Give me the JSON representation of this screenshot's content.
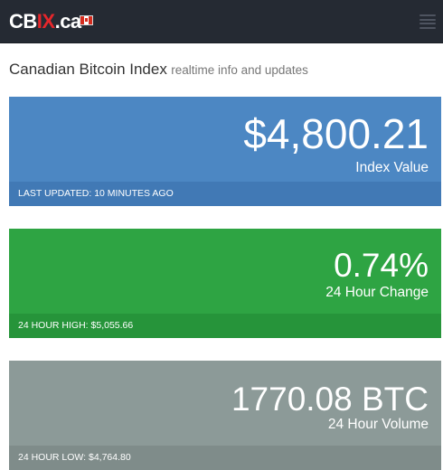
{
  "navbar": {
    "brand_part1": "CB",
    "brand_part2": "IX",
    "brand_part3": ".ca",
    "flag_icon": "canada-flag-icon",
    "menu_icon": "hamburger-menu-icon"
  },
  "header": {
    "title": "Canadian Bitcoin Index",
    "subtitle": "realtime info and updates"
  },
  "panels": {
    "index": {
      "value": "$4,800.21",
      "label": "Index Value",
      "footer": "LAST UPDATED: 10 MINUTES AGO",
      "color": "#4c87c3"
    },
    "change": {
      "value": "0.74%",
      "label": "24 Hour Change",
      "footer": "24 HOUR HIGH: $5,055.66",
      "color": "#2ea443"
    },
    "volume": {
      "value": "1770.08 BTC",
      "label": "24 Hour Volume",
      "footer": "24 HOUR LOW: $4,764.80",
      "color": "#8c9a98"
    }
  },
  "colors": {
    "navbar_bg": "#252a33",
    "brand_accent": "#e5262b"
  }
}
